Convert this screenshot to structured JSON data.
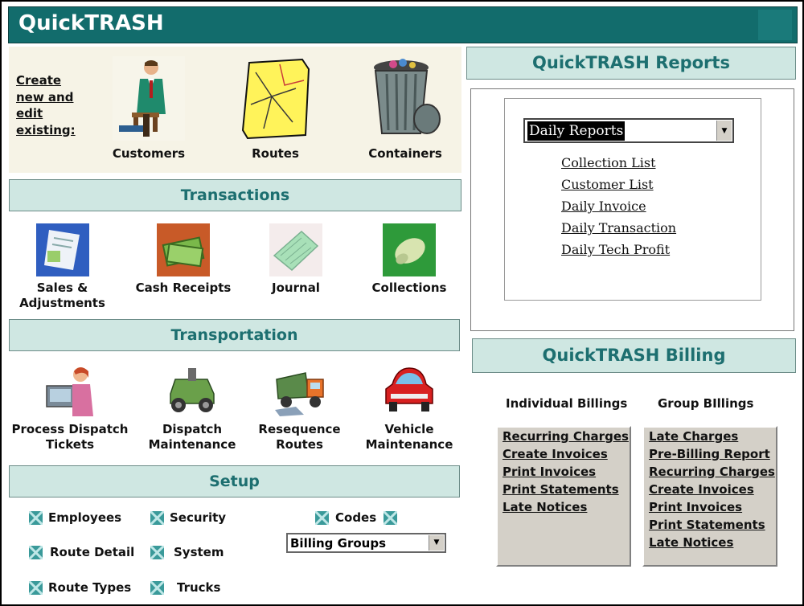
{
  "app": {
    "title": "QuickTRASH"
  },
  "create": {
    "label_lines": [
      "Create",
      "new and",
      "edit",
      "existing:"
    ],
    "items": [
      {
        "label": "Customers",
        "icon": "customer-icon"
      },
      {
        "label": "Routes",
        "icon": "map-icon"
      },
      {
        "label": "Containers",
        "icon": "trash-can-icon"
      }
    ]
  },
  "transactions": {
    "title": "Transactions",
    "items": [
      {
        "label_lines": [
          "Sales &",
          "Adjustments"
        ],
        "icon": "sales-document-icon"
      },
      {
        "label_lines": [
          "Cash Receipts"
        ],
        "icon": "cash-icon"
      },
      {
        "label_lines": [
          "Journal"
        ],
        "icon": "journal-paper-icon"
      },
      {
        "label_lines": [
          "Collections"
        ],
        "icon": "money-roll-icon"
      }
    ]
  },
  "transportation": {
    "title": "Transportation",
    "items": [
      {
        "label_lines": [
          "Process Dispatch",
          "Tickets"
        ],
        "icon": "dispatcher-icon"
      },
      {
        "label_lines": [
          "Dispatch",
          "Maintenance"
        ],
        "icon": "tractor-icon"
      },
      {
        "label_lines": [
          "Resequence",
          "Routes"
        ],
        "icon": "dump-truck-icon"
      },
      {
        "label_lines": [
          "Vehicle",
          "Maintenance"
        ],
        "icon": "red-car-icon"
      }
    ]
  },
  "setup": {
    "title": "Setup",
    "items": [
      "Employees",
      "Security",
      "Codes",
      "Route Detail",
      "System",
      "Route Types",
      "Trucks"
    ],
    "dropdown_value": "Billing Groups"
  },
  "reports": {
    "title": "QuickTRASH Reports",
    "dropdown_value": "Daily Reports",
    "links": [
      "Collection List",
      "Customer List",
      "Daily Invoice",
      "Daily Transaction",
      "Daily Tech Profit"
    ]
  },
  "billing": {
    "title": "QuickTRASH Billing",
    "individual": {
      "heading": "Individual Billings",
      "links": [
        "Recurring Charges",
        "Create Invoices",
        "Print Invoices",
        "Print Statements",
        "Late Notices"
      ]
    },
    "group": {
      "heading": "Group BIllings",
      "links": [
        "Late Charges",
        "Pre-Billing Report",
        "Recurring Charges",
        "Create Invoices",
        "Print Invoices",
        "Print Statements",
        "Late Notices"
      ]
    }
  },
  "colors": {
    "title_bar": "#126c6c",
    "band_bg": "#cfe7e2",
    "band_text": "#1d6f70"
  }
}
